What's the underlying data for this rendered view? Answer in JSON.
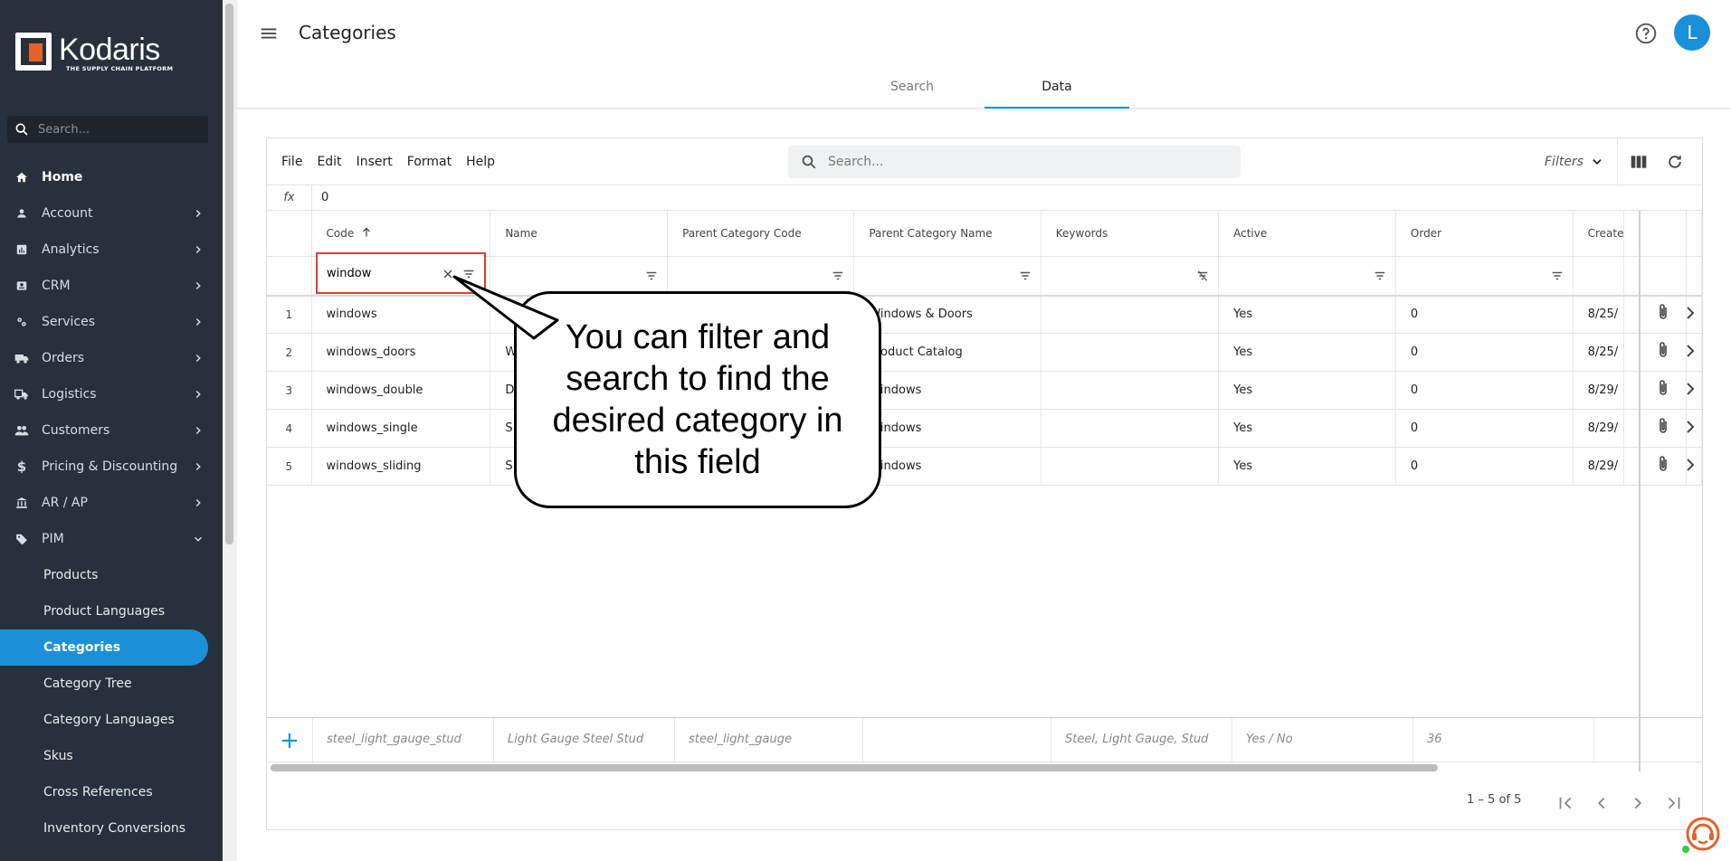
{
  "brand": {
    "name": "Kodaris",
    "tagline": "THE SUPPLY CHAIN PLATFORM"
  },
  "sidebar": {
    "search_placeholder": "Search...",
    "items": [
      {
        "label": "Home",
        "icon": "home-icon"
      },
      {
        "label": "Account",
        "icon": "person-icon"
      },
      {
        "label": "Analytics",
        "icon": "analytics-icon"
      },
      {
        "label": "CRM",
        "icon": "contact-card-icon"
      },
      {
        "label": "Services",
        "icon": "services-icon"
      },
      {
        "label": "Orders",
        "icon": "truck-icon"
      },
      {
        "label": "Logistics",
        "icon": "shipping-icon"
      },
      {
        "label": "Customers",
        "icon": "people-icon"
      },
      {
        "label": "Pricing & Discounting",
        "icon": "dollar-icon"
      },
      {
        "label": "AR / AP",
        "icon": "bank-icon"
      },
      {
        "label": "PIM",
        "icon": "tag-icon"
      }
    ],
    "pim_items": [
      "Products",
      "Product Languages",
      "Categories",
      "Category Tree",
      "Category Languages",
      "Skus",
      "Cross References",
      "Inventory Conversions"
    ]
  },
  "header": {
    "title": "Categories",
    "avatar_initial": "L",
    "tabs": [
      "Search",
      "Data"
    ]
  },
  "toolbar": {
    "menus": [
      "File",
      "Edit",
      "Insert",
      "Format",
      "Help"
    ],
    "search_placeholder": "Search...",
    "filters_label": "Filters"
  },
  "formula": {
    "label": "fx",
    "value": "0"
  },
  "table": {
    "columns": [
      "Code",
      "Name",
      "Parent Category Code",
      "Parent Category Name",
      "Keywords",
      "Active",
      "Order",
      "Create"
    ],
    "code_filter": "window",
    "rows": [
      {
        "n": "1",
        "code": "windows",
        "name": "",
        "pcode": "",
        "pname": "Windows & Doors",
        "keywords": "",
        "active": "Yes",
        "order": "0",
        "created": "8/25/"
      },
      {
        "n": "2",
        "code": "windows_doors",
        "name": "W",
        "pcode": "",
        "pname": "Product Catalog",
        "keywords": "",
        "active": "Yes",
        "order": "0",
        "created": "8/25/"
      },
      {
        "n": "3",
        "code": "windows_double",
        "name": "D",
        "pcode": "",
        "pname": "Windows",
        "keywords": "",
        "active": "Yes",
        "order": "0",
        "created": "8/29/"
      },
      {
        "n": "4",
        "code": "windows_single",
        "name": "S",
        "pcode": "",
        "pname": "Windows",
        "keywords": "",
        "active": "Yes",
        "order": "0",
        "created": "8/29/"
      },
      {
        "n": "5",
        "code": "windows_sliding",
        "name": "S",
        "pcode": "",
        "pname": "Windows",
        "keywords": "",
        "active": "Yes",
        "order": "0",
        "created": "8/29/"
      }
    ],
    "new_row": {
      "code": "steel_light_gauge_stud",
      "name": "Light Gauge Steel Stud",
      "pcode": "steel_light_gauge",
      "keywords": "Steel, Light Gauge, Stud",
      "active": "Yes / No",
      "order": "36"
    }
  },
  "pagination": {
    "range": "1 – 5 of 5"
  },
  "callout": {
    "text": "You can filter and search to find the desired category in this field"
  }
}
